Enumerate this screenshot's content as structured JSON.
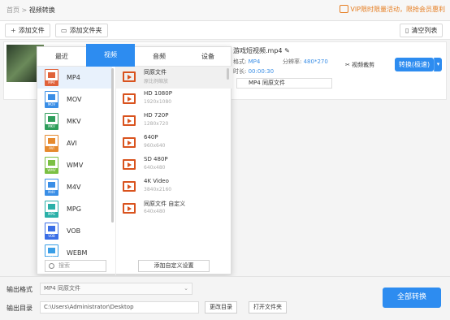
{
  "breadcrumb": {
    "home": "首页",
    "sep": ">",
    "current": "视频转换"
  },
  "vip": {
    "text": "VIP限时限量活动，限抢会员惠利"
  },
  "toolbar": {
    "add_file": "添加文件",
    "add_folder": "添加文件夹",
    "clear_list": "清空列表",
    "add_file_icon": "+",
    "add_folder_icon": "folder-icon",
    "clear_icon": "trash-icon"
  },
  "file": {
    "name": "游戏短视频.mp4",
    "format_label": "格式:",
    "format": "MP4",
    "resolution_label": "分辨率:",
    "resolution": "480*270",
    "duration_label": "时长:",
    "duration": "00:00:30",
    "output_select": "MP4  同原文件",
    "clip_label": "视频裁剪",
    "convert_label": "转换(极速)",
    "convert_arrow": "▾"
  },
  "popup": {
    "tabs": [
      "最近",
      "视频",
      "音频",
      "设备"
    ],
    "active_tab": 1,
    "categories": [
      {
        "name": "MP4",
        "band": "MP4",
        "color": "#e0623a"
      },
      {
        "name": "MOV",
        "band": "MOV",
        "color": "#3a8ee6"
      },
      {
        "name": "MKV",
        "band": "MKV",
        "color": "#2e9e5b"
      },
      {
        "name": "AVI",
        "band": "AVI",
        "color": "#e68a2e"
      },
      {
        "name": "WMV",
        "band": "WMV",
        "color": "#7bc043"
      },
      {
        "name": "M4V",
        "band": "M4V",
        "color": "#3a8ee6"
      },
      {
        "name": "MPG",
        "band": "MPG",
        "color": "#2ab0a8"
      },
      {
        "name": "VOB",
        "band": "VOB",
        "color": "#3a6ee6"
      },
      {
        "name": "WEBM",
        "band": "WEBM",
        "color": "#3a9ee6"
      }
    ],
    "options": [
      {
        "title": "同原文件",
        "sub": "原比例缩放"
      },
      {
        "title": "HD 1080P",
        "sub": "1920x1080"
      },
      {
        "title": "HD 720P",
        "sub": "1280x720"
      },
      {
        "title": "640P",
        "sub": "960x640"
      },
      {
        "title": "SD 480P",
        "sub": "640x480"
      },
      {
        "title": "4K Video",
        "sub": "3840x2160"
      },
      {
        "title": "同原文件 自定义",
        "sub": "640x480"
      }
    ],
    "search_placeholder": "搜索",
    "add_custom": "添加自定义设置"
  },
  "bottom": {
    "format_label": "输出格式",
    "format_value": "MP4  同原文件",
    "dir_label": "输出目录",
    "dir_value": "C:\\Users\\Administrator\\Desktop",
    "change_dir": "更改目录",
    "open_folder": "打开文件夹",
    "convert_all": "全部转换"
  },
  "colors": {
    "accent": "#2d8cf0",
    "vip": "#e67e22",
    "video_icon": "#d9531e"
  }
}
